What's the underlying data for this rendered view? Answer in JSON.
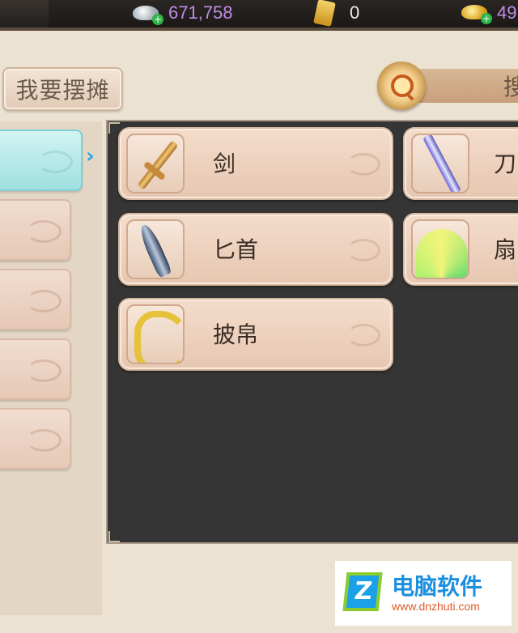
{
  "currency": {
    "silver": "671,758",
    "ticket": "0",
    "gold": "49"
  },
  "toolbar": {
    "stall_label": "我要摆摊",
    "search_label": "搜"
  },
  "items": [
    {
      "name": "剑",
      "icon": "sword-icon"
    },
    {
      "name": "刀",
      "icon": "blade-icon"
    },
    {
      "name": "匕首",
      "icon": "dagger-icon"
    },
    {
      "name": "扇",
      "icon": "fan-icon"
    },
    {
      "name": "披帛",
      "icon": "shawl-icon"
    }
  ],
  "watermark": {
    "logo": "Z",
    "title": "电脑软件",
    "url": "www.dnzhuti.com"
  },
  "colors": {
    "accent_cyan": "#9fe0e0",
    "silver_text": "#c08de6",
    "panel_dark": "#353535"
  }
}
